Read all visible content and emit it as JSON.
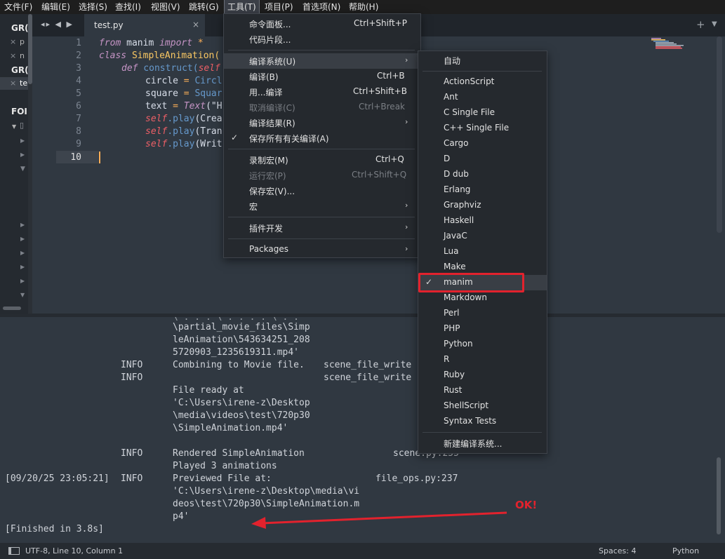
{
  "menubar": {
    "items": [
      "文件(F)",
      "编辑(E)",
      "选择(S)",
      "查找(I)",
      "视图(V)",
      "跳转(G)",
      "工具(T)",
      "项目(P)",
      "首选项(N)",
      "帮助(H)"
    ]
  },
  "sidebar": {
    "group1": "GR(",
    "file1": "p",
    "file2": "n",
    "group2": "GR(",
    "file3": "te",
    "folders": "FOI"
  },
  "tabs": {
    "active": "test.py",
    "close": "×",
    "nav": "◂▸ ◀ ▶",
    "new_tab": "+",
    "dropdown": "▼"
  },
  "editor": {
    "line_numbers": [
      "1",
      "2",
      "3",
      "4",
      "5",
      "6",
      "7",
      "8",
      "9",
      "10"
    ],
    "code": {
      "l1_from": "from",
      "l1_mod": " manim ",
      "l1_import": "import",
      "l1_star": " *",
      "l2_class": "class",
      "l2_name": " SimpleAnimation(",
      "l3_def": "def",
      "l3_name": " construct(",
      "l3_self": "self",
      "l4_var": "circle ",
      "l4_eq": "=",
      "l4_rhs": " Circl",
      "l5_var": "square ",
      "l5_eq": "=",
      "l5_rhs": " Squar",
      "l6_var": "text ",
      "l6_eq": "=",
      "l6_text": " Text",
      "l6_rest": "(\"H",
      "l7_self": "self",
      "l7_play": ".play",
      "l7_rest": "(Crea",
      "l8_self": "self",
      "l8_play": ".play",
      "l8_rest": "(Tran",
      "l9_self": "self",
      "l9_play": ".play",
      "l9_rest": "(Writ"
    }
  },
  "tools_menu": {
    "items": [
      {
        "label": "命令面板...",
        "shortcut": "Ctrl+Shift+P"
      },
      {
        "label": "代码片段..."
      },
      {
        "label": "编译系统(U)",
        "submenu": true,
        "highlighted": true
      },
      {
        "label": "编译(B)",
        "shortcut": "Ctrl+B"
      },
      {
        "label": "用...编译",
        "shortcut": "Ctrl+Shift+B"
      },
      {
        "label": "取消编译(C)",
        "shortcut": "Ctrl+Break",
        "disabled": true
      },
      {
        "label": "编译结果(R)",
        "submenu": true
      },
      {
        "label": "保存所有有关编译(A)",
        "checked": true
      },
      {
        "label": "录制宏(M)",
        "shortcut": "Ctrl+Q"
      },
      {
        "label": "运行宏(P)",
        "shortcut": "Ctrl+Shift+Q",
        "disabled": true
      },
      {
        "label": "保存宏(V)..."
      },
      {
        "label": "宏",
        "submenu": true
      },
      {
        "label": "插件开发",
        "submenu": true
      },
      {
        "label": "Packages",
        "submenu": true
      }
    ]
  },
  "build_menu": {
    "items": [
      "自动",
      "ActionScript",
      "Ant",
      "C Single File",
      "C++ Single File",
      "Cargo",
      "D",
      "D dub",
      "Erlang",
      "Graphviz",
      "Haskell",
      "JavaC",
      "Lua",
      "Make",
      "manim",
      "Markdown",
      "Perl",
      "PHP",
      "Python",
      "R",
      "Ruby",
      "Rust",
      "ShellScript",
      "Syntax Tests",
      "新建编译系统..."
    ],
    "checked": "manim"
  },
  "output": {
    "path1": "\\partial_movie_files\\Simp",
    "path2": "leAnimation\\543634251_208",
    "path3": "5720903_1235619311.mp4'",
    "info1_level": "INFO",
    "info1_msg": "Combining to Movie file.",
    "info1_src": "scene_file_write",
    "info2_level": "INFO",
    "info2_src": "scene_file_write",
    "ready1": "File ready at",
    "ready2": "'C:\\Users\\irene-z\\Desktop",
    "ready3": "\\media\\videos\\test\\720p30",
    "ready4": "\\SimpleAnimation.mp4'",
    "info3_level": "INFO",
    "info3_msg": "Rendered SimpleAnimation",
    "info3_src": "scene.py:255",
    "played": "Played 3 animations",
    "ts": "[09/20/25 23:05:21]",
    "info4_level": "INFO",
    "info4_msg": "Previewed File at:",
    "info4_src": "file_ops.py:237",
    "prev1": "'C:\\Users\\irene-z\\Desktop\\media\\vi",
    "prev2": "deos\\test\\720p30\\SimpleAnimation.m",
    "prev3": "p4'",
    "finished": "[Finished in 3.8s]"
  },
  "annotation": {
    "ok_text": "OK!",
    "color": "#e2222d"
  },
  "statusbar": {
    "encoding": "UTF-8, Line 10, Column 1",
    "spaces": "Spaces: 4",
    "syntax": "Python"
  },
  "colors": {
    "editor_bg": "#303841",
    "keyword": "#c594c5",
    "class_name": "#fac863",
    "function": "#6699cc",
    "self": "#ec5f66",
    "operator": "#f9ae58"
  }
}
